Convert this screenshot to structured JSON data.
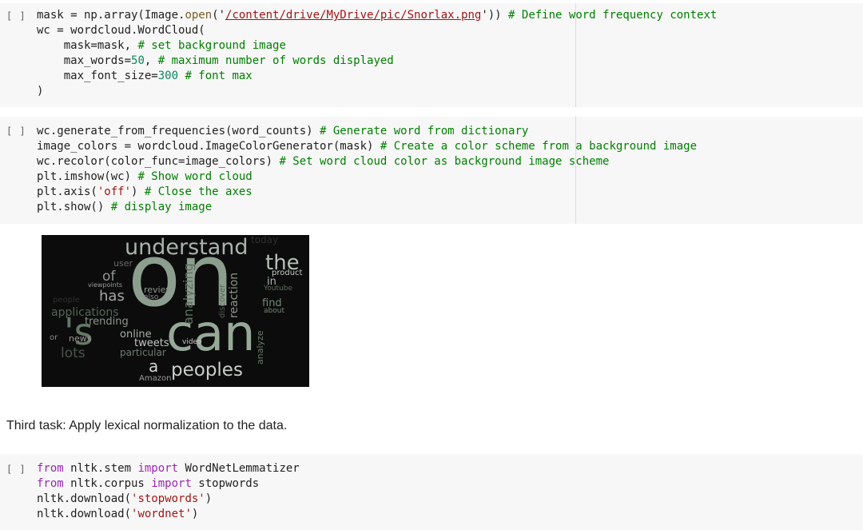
{
  "cells": {
    "cell1": {
      "run_label": "[ ]",
      "l1_a": "mask = np.array(Image.",
      "l1_b": "open",
      "l1_c": "('",
      "l1_d": "/content/drive/MyDrive/pic/Snorlax.png",
      "l1_e": "')) ",
      "l1_f": "# Define word frequency context",
      "l2": "wc = wordcloud.WordCloud(",
      "l3_a": "    mask=mask, ",
      "l3_b": "# set background image",
      "l4_a": "    max_words=",
      "l4_b": "50",
      "l4_c": ", ",
      "l4_d": "# maximum number of words displayed",
      "l5_a": "    max_font_size=",
      "l5_b": "300",
      "l5_c": " ",
      "l5_d": "# font max",
      "l6": ")"
    },
    "cell2": {
      "run_label": "[ ]",
      "l1_a": "wc.generate_from_frequencies(word_counts) ",
      "l1_b": "# Generate word from dictionary",
      "l2_a": "image_colors = wordcloud.ImageColorGenerator(mask) ",
      "l2_b": "# Create a color scheme from a background image",
      "l3_a": "wc.recolor(color_func=image_colors) ",
      "l3_b": "# Set word cloud color as background image scheme",
      "l4_a": "plt.imshow(wc) ",
      "l4_b": "# Show word cloud",
      "l5_a": "plt.axis(",
      "l5_b": "'off'",
      "l5_c": ") ",
      "l5_d": "# Close the axes",
      "l6_a": "plt.show() ",
      "l6_b": "# display image"
    },
    "cell3": {
      "run_label": "[ ]",
      "l1_a": "from",
      "l1_b": " nltk.stem ",
      "l1_c": "import",
      "l1_d": " WordNetLemmatizer",
      "l2_a": "from",
      "l2_b": " nltk.corpus ",
      "l2_c": "import",
      "l2_d": " stopwords",
      "l3_a": "nltk.download(",
      "l3_b": "'stopwords'",
      "l3_c": ")",
      "l4_a": "nltk.download(",
      "l4_b": "'wordnet'",
      "l4_c": ")"
    }
  },
  "wordcloud": {
    "words": {
      "on": "on",
      "can": "can",
      "s": "'s",
      "understand": "understand",
      "today": "today",
      "the": "the",
      "product": "product",
      "in": "in",
      "youtube": "Youtube",
      "find": "find",
      "about": "about",
      "user": "user",
      "of": "of",
      "viewpoints": "viewpoints",
      "review": "review",
      "also": "also",
      "has": "has",
      "people": "people",
      "applications": "applications",
      "trending": "trending",
      "analyzing": "analyzing",
      "discover": "discover",
      "reaction": "reaction",
      "online": "online",
      "tweets": "tweets",
      "particular": "particular",
      "video": "video",
      "or": "or",
      "news": "news",
      "lots": "lots",
      "analyze": "analyze",
      "a": "a",
      "peoples": "peoples",
      "amazon": "Amazon"
    }
  },
  "markdown": {
    "text": "Third task: Apply lexical normalization to the data."
  }
}
